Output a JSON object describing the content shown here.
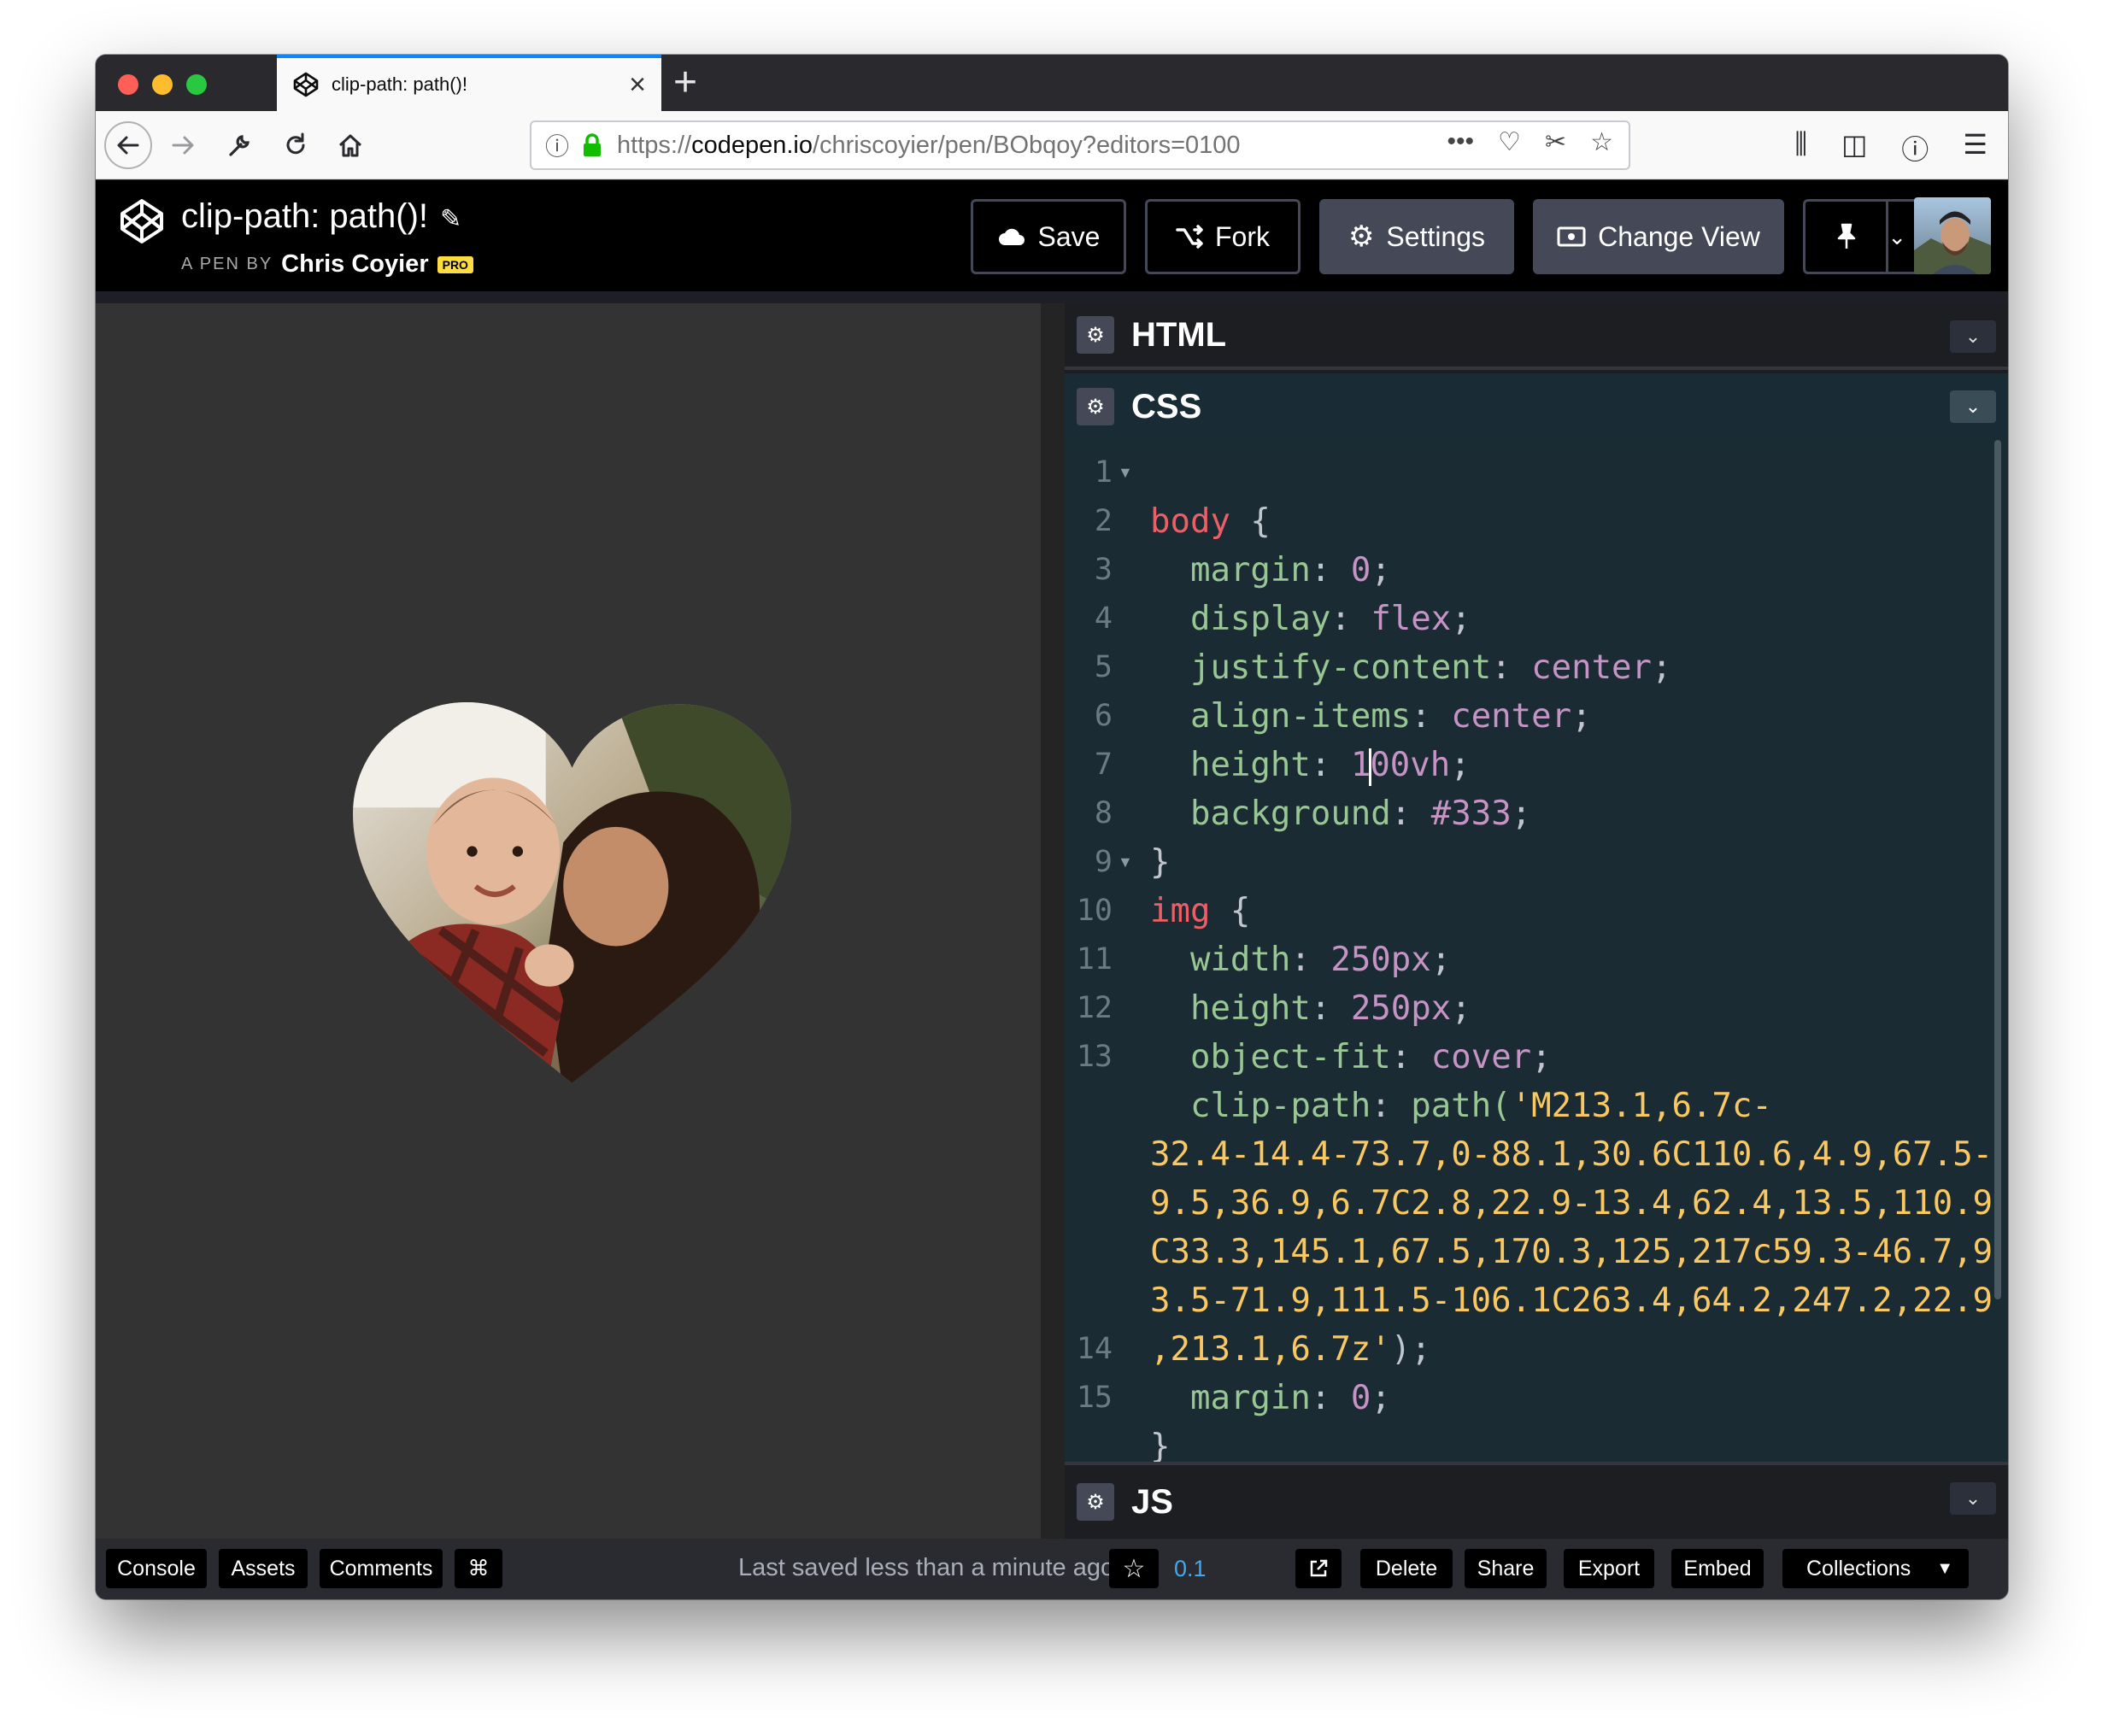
{
  "browser": {
    "tab_title": "clip-path: path()!",
    "new_tab": "+",
    "close_tab": "×",
    "url_scheme": "https://",
    "url_host": "codepen.io",
    "url_path": "/chriscoyier/pen/BObqoy?editors=0100"
  },
  "header": {
    "pen_title": "clip-path: path()!",
    "pen_by": "A PEN BY",
    "author": "Chris Coyier",
    "pro_badge": "PRO",
    "buttons": {
      "save": "Save",
      "fork": "Fork",
      "settings": "Settings",
      "change_view": "Change View"
    }
  },
  "editors": {
    "html_label": "HTML",
    "css_label": "CSS",
    "js_label": "JS",
    "line_numbers": [
      "1",
      "2",
      "3",
      "4",
      "5",
      "6",
      "7",
      "8",
      "9",
      "10",
      "11",
      "12",
      "13",
      "14",
      "15"
    ]
  },
  "css_code": {
    "l1_sel": "body",
    "l1_brace": " {",
    "l2_prop": "margin",
    "l2_val": "0",
    "l3_prop": "display",
    "l3_val": "flex",
    "l4_prop": "justify-content",
    "l4_val": "center",
    "l5_prop": "align-items",
    "l5_val": "center",
    "l6_prop": "height",
    "l6_val_a": "1",
    "l6_val_b": "00vh",
    "l7_prop": "background",
    "l7_val": "#333",
    "l8": "}",
    "l9_sel": "img",
    "l9_brace": " {",
    "l10_prop": "width",
    "l10_val": "250px",
    "l11_prop": "height",
    "l11_val": "250px",
    "l12_prop": "object-fit",
    "l12_val": "cover",
    "l13_prop": "clip-path",
    "l13_fn": "path(",
    "l13_str1": "'M213.1,6.7c-",
    "l13_str2": "32.4-14.4-73.7,0-88.1,30.6C110.6,4.9,67.5-",
    "l13_str3": "9.5,36.9,6.7C2.8,22.9-13.4,62.4,13.5,110.9",
    "l13_str4": "C33.3,145.1,67.5,170.3,125,217c59.3-46.7,9",
    "l13_str5": "3.5-71.9,111.5-106.1C263.4,64.2,247.2,22.9",
    "l13_str6": ",213.1,6.7z'",
    "l13_end": ");",
    "l14_prop": "margin",
    "l14_val": "0",
    "l15": "}"
  },
  "footer": {
    "console": "Console",
    "assets": "Assets",
    "comments": "Comments",
    "shortcuts": "⌘",
    "saved_status": "Last saved less than a minute ago",
    "version": "0.1",
    "delete": "Delete",
    "share": "Share",
    "export": "Export",
    "embed": "Embed",
    "collections": "Collections"
  },
  "colors": {
    "preview_background": "#333333",
    "editor_background": "#1b2b34",
    "selector": "#ec5f67",
    "property": "#99c794",
    "value": "#c594c5",
    "string": "#fac863"
  },
  "icons": [
    "codepen-logo-icon",
    "pencil-icon",
    "cloud-icon",
    "fork-icon",
    "gear-icon",
    "eye-icon",
    "pin-icon",
    "chevron-down-icon",
    "star-icon",
    "external-link-icon"
  ]
}
